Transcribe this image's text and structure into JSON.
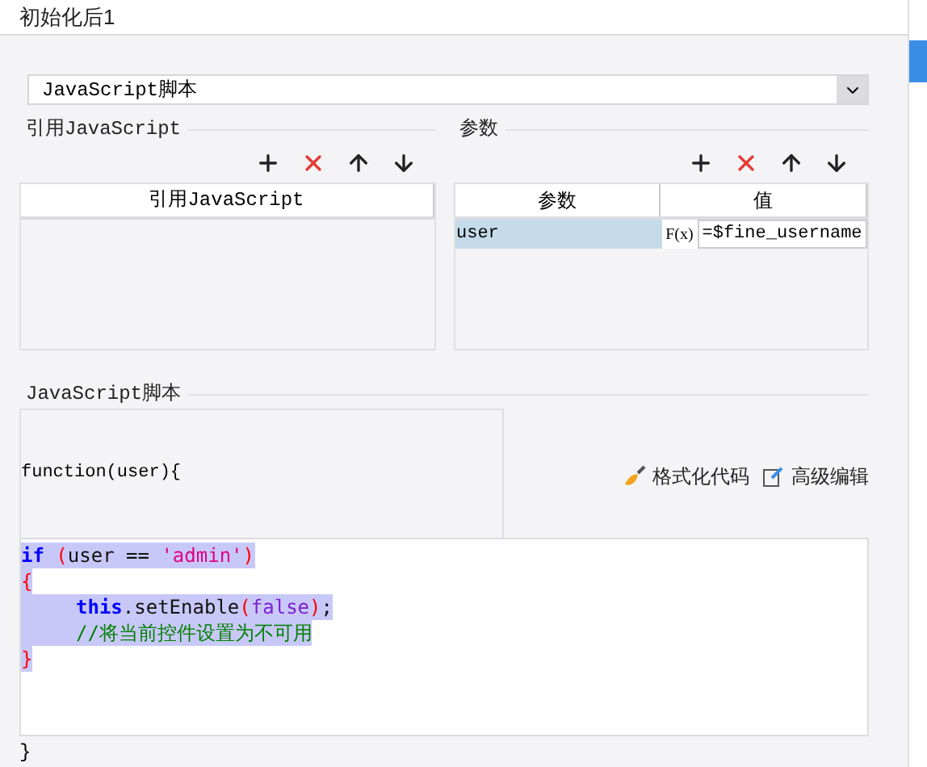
{
  "window": {
    "title": "初始化后1"
  },
  "script_type": {
    "value": "JavaScript脚本"
  },
  "referenced_js": {
    "title": "引用JavaScript",
    "columns": [
      "引用JavaScript"
    ]
  },
  "parameters": {
    "title": "参数",
    "columns": [
      "参数",
      "值"
    ],
    "rows": [
      {
        "name": "user",
        "formula_icon": "F(x)",
        "value": "=$fine_username",
        "selected": true
      }
    ]
  },
  "script": {
    "title": "JavaScript脚本",
    "header": "function(user){",
    "footer": "}",
    "actions": [
      "格式化代码",
      "高级编辑"
    ],
    "lines": [
      {
        "selected": true,
        "indented": false,
        "tokens": [
          {
            "kind": "keyword",
            "text": "if"
          },
          {
            "kind": "paren",
            "text": " ("
          },
          {
            "kind": "plain",
            "text": "user == "
          },
          {
            "kind": "string",
            "text": "'admin'"
          },
          {
            "kind": "paren",
            "text": ")"
          }
        ]
      },
      {
        "selected": true,
        "indented": false,
        "tokens": [
          {
            "kind": "paren",
            "text": "{"
          }
        ]
      },
      {
        "selected": true,
        "indented": true,
        "tokens": [
          {
            "kind": "keyword",
            "text": "this"
          },
          {
            "kind": "plain",
            "text": ".setEnable"
          },
          {
            "kind": "paren",
            "text": "("
          },
          {
            "kind": "literal",
            "text": "false"
          },
          {
            "kind": "paren",
            "text": ")"
          },
          {
            "kind": "plain",
            "text": ";"
          }
        ]
      },
      {
        "selected": true,
        "indented": true,
        "tokens": [
          {
            "kind": "comment",
            "text": "//将当前控件设置为不可用"
          }
        ]
      },
      {
        "selected": true,
        "indented": false,
        "tokens": [
          {
            "kind": "paren",
            "text": "}"
          }
        ]
      }
    ]
  }
}
